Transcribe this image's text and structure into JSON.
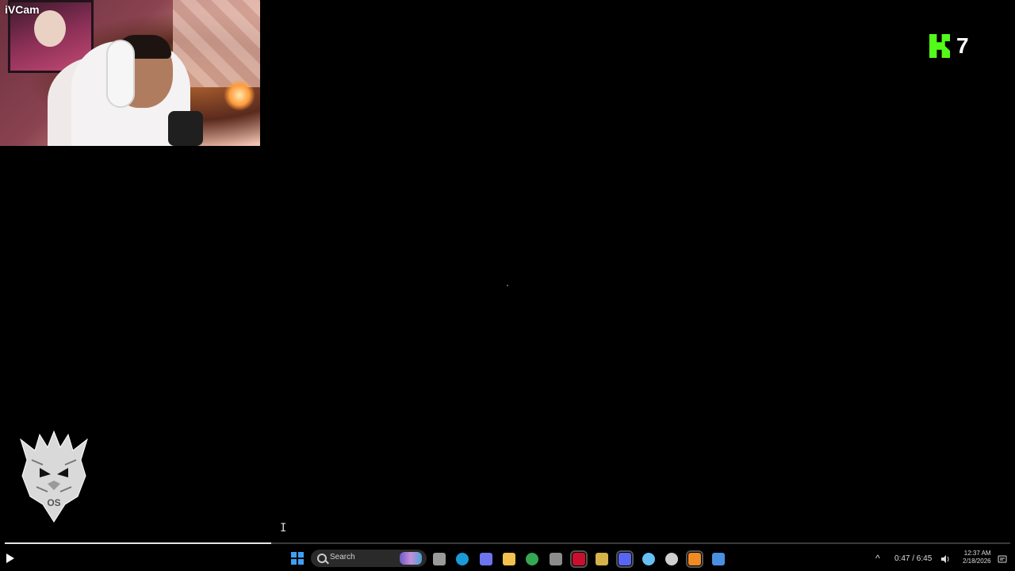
{
  "webcam": {
    "label": "iVCam"
  },
  "kick": {
    "count": "7",
    "color": "#53fc18",
    "icon": "kick-logo-icon"
  },
  "logo": {
    "icon": "dragon-logo-icon",
    "initials": "OS"
  },
  "player": {
    "progress_fraction": 0.265,
    "play_icon": "play-icon"
  },
  "taskbar": {
    "search_placeholder": "Search",
    "apps": [
      {
        "name": "task-view",
        "icon": "task-view-icon",
        "color": "#9a9a9a"
      },
      {
        "name": "edge",
        "icon": "edge-browser-icon",
        "color": "#1a9bd7"
      },
      {
        "name": "copilot",
        "icon": "copilot-icon",
        "color": "#6c74f0"
      },
      {
        "name": "file-explorer",
        "icon": "folder-icon",
        "color": "#f2c14e"
      },
      {
        "name": "chrome",
        "icon": "chrome-icon",
        "color": "#34a853"
      },
      {
        "name": "store",
        "icon": "store-icon",
        "color": "#8c8c8c"
      },
      {
        "name": "adobe",
        "icon": "adobe-icon",
        "color": "#c8102e"
      },
      {
        "name": "app-yellow",
        "icon": "app-icon",
        "color": "#d6b24a"
      },
      {
        "name": "discord",
        "icon": "discord-icon",
        "color": "#5865f2"
      },
      {
        "name": "steam",
        "icon": "steam-icon",
        "color": "#66c0f4"
      },
      {
        "name": "obs",
        "icon": "obs-icon",
        "color": "#cfcfcf"
      },
      {
        "name": "app-orange",
        "icon": "app-icon",
        "color": "#f08a24"
      },
      {
        "name": "app-blue",
        "icon": "app-icon",
        "color": "#4a90e2"
      }
    ],
    "media_time": "0:47 / 6:45",
    "clock_time": "12:37 AM",
    "clock_date": "2/18/2026"
  }
}
